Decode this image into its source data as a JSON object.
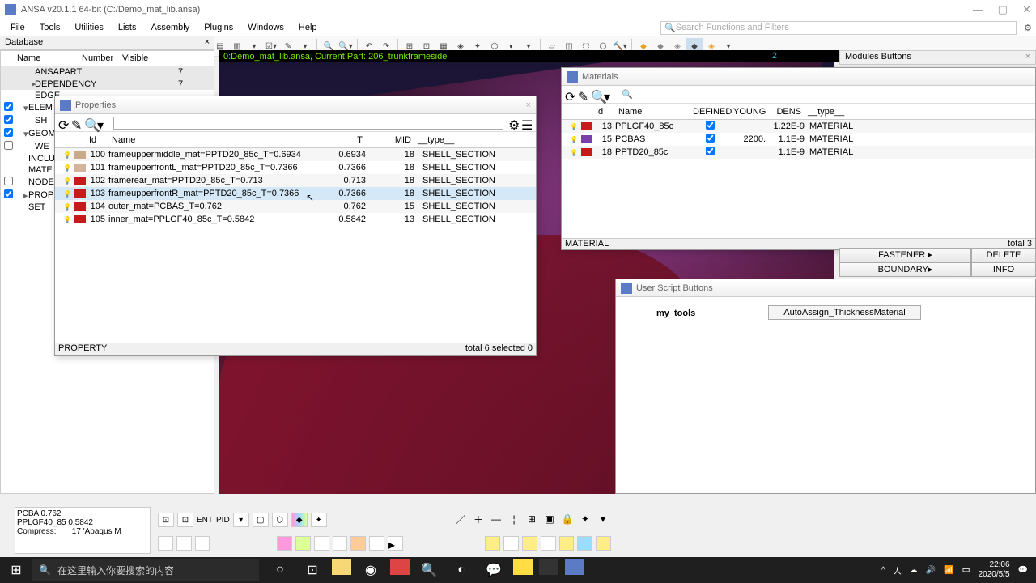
{
  "window": {
    "title": "ANSA v20.1.1 64-bit (C:/Demo_mat_lib.ansa)"
  },
  "menu": [
    "File",
    "Tools",
    "Utilities",
    "Lists",
    "Assembly",
    "Plugins",
    "Windows",
    "Help"
  ],
  "search_placeholder": "Search Functions and Filters",
  "database": {
    "header": "Database",
    "cols": [
      "Name",
      "Number",
      "Visible"
    ],
    "rows": [
      {
        "name": "ANSAPART",
        "num": "7",
        "indent": 2
      },
      {
        "name": "DEPENDENCY",
        "num": "7",
        "indent": 2,
        "expander": "▸"
      },
      {
        "name": "EDGE",
        "num": "",
        "indent": 2
      },
      {
        "name": "ELEM",
        "num": "",
        "indent": 1,
        "expander": "▾",
        "chk": true
      },
      {
        "name": "SH",
        "num": "",
        "indent": 2,
        "chk": true
      },
      {
        "name": "GEOM",
        "num": "",
        "indent": 1,
        "expander": "▾",
        "chk": true
      },
      {
        "name": "WE",
        "num": "",
        "indent": 2,
        "chk": false
      },
      {
        "name": "INCLU",
        "num": "",
        "indent": 1
      },
      {
        "name": "MATE",
        "num": "",
        "indent": 1
      },
      {
        "name": "NODE",
        "num": "",
        "indent": 1,
        "chk": false
      },
      {
        "name": "PROP",
        "num": "",
        "indent": 1,
        "expander": "▸",
        "chk": true
      },
      {
        "name": "SET",
        "num": "",
        "indent": 1
      }
    ]
  },
  "viewport": {
    "info": "0:Demo_mat_lib.ansa,  Current Part: 206_trunkframeside",
    "num": "2"
  },
  "modules_bar": "Modules Buttons",
  "properties": {
    "title": "Properties",
    "cols": [
      "Id",
      "Name",
      "T",
      "MID",
      "__type__"
    ],
    "rows": [
      {
        "id": "100",
        "name": "frameuppermiddle_mat=PPTD20_85c_T=0.6934",
        "t": "0.6934",
        "mid": "18",
        "type": "SHELL_SECTION",
        "color": "#c9a98a"
      },
      {
        "id": "101",
        "name": "frameupperfrontL_mat=PPTD20_85c_T=0.7366",
        "t": "0.7366",
        "mid": "18",
        "type": "SHELL_SECTION",
        "color": "#d4b59b"
      },
      {
        "id": "102",
        "name": "framerear_mat=PPTD20_85c_T=0.713",
        "t": "0.713",
        "mid": "18",
        "type": "SHELL_SECTION",
        "color": "#c71a1a"
      },
      {
        "id": "103",
        "name": "frameupperfrontR_mat=PPTD20_85c_T=0.7366",
        "t": "0.7366",
        "mid": "18",
        "type": "SHELL_SECTION",
        "color": "#c71a1a",
        "hl": true
      },
      {
        "id": "104",
        "name": "outer_mat=PCBAS_T=0.762",
        "t": "0.762",
        "mid": "15",
        "type": "SHELL_SECTION",
        "color": "#c71a1a"
      },
      {
        "id": "105",
        "name": "inner_mat=PPLGF40_85c_T=0.5842",
        "t": "0.5842",
        "mid": "13",
        "type": "SHELL_SECTION",
        "color": "#c71a1a"
      }
    ],
    "status_left": "PROPERTY",
    "status_right": "total 6  selected 0"
  },
  "materials": {
    "title": "Materials",
    "cols": [
      "Id",
      "Name",
      "DEFINED",
      "YOUNG",
      "DENS",
      "__type__"
    ],
    "rows": [
      {
        "id": "13",
        "name": "PPLGF40_85c",
        "def": true,
        "young": "",
        "dens": "1.22E-9",
        "type": "MATERIAL",
        "color": "#c71a1a"
      },
      {
        "id": "15",
        "name": "PCBAS",
        "def": true,
        "young": "2200.",
        "dens": "1.1E-9",
        "type": "MATERIAL",
        "color": "#7a3fa8"
      },
      {
        "id": "18",
        "name": "PPTD20_85c",
        "def": true,
        "young": "",
        "dens": "1.1E-9",
        "type": "MATERIAL",
        "color": "#c71a1a"
      }
    ],
    "status_left": "MATERIAL",
    "status_right": "total 3"
  },
  "side_buttons": {
    "row1": [
      "FASTENER ▸",
      "DELETE"
    ],
    "row2": [
      "BOUNDARY▸",
      "INFO"
    ]
  },
  "script_window": {
    "title": "User Script Buttons",
    "label": "my_tools",
    "button": "AutoAssign_ThicknessMaterial"
  },
  "bottom_log": "PCBA 0.762\nPPLGF40_85 0.5842\nCompress:       17 'Abaqus M",
  "bottom_labels": [
    "ENT",
    "PID"
  ],
  "taskbar": {
    "search": "在这里输入你要搜索的内容",
    "time": "22:06",
    "date": "2020/5/5"
  }
}
